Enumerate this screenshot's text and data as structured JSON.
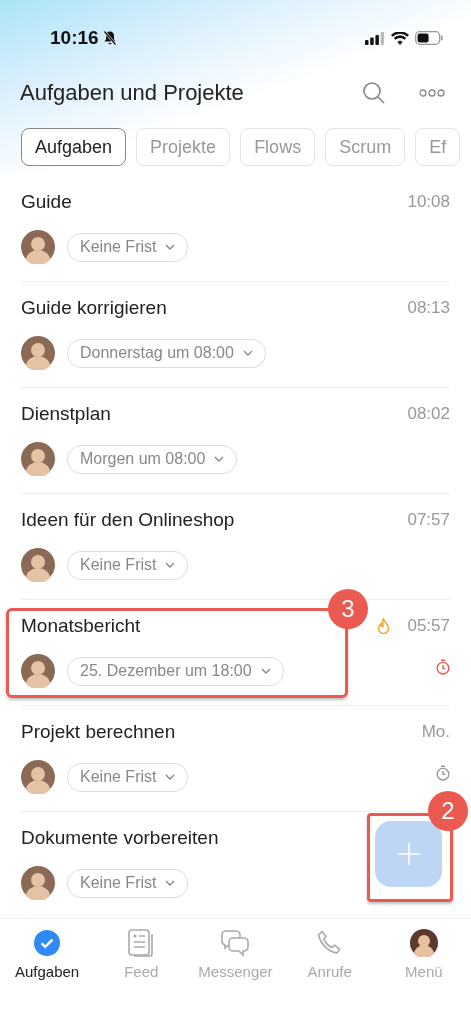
{
  "status_bar": {
    "time": "10:16"
  },
  "header": {
    "title": "Aufgaben und Projekte"
  },
  "tabs": [
    {
      "label": "Aufgaben",
      "selected": true
    },
    {
      "label": "Projekte",
      "selected": false
    },
    {
      "label": "Flows",
      "selected": false
    },
    {
      "label": "Scrum",
      "selected": false
    },
    {
      "label": "Ef",
      "selected": false
    }
  ],
  "tasks": [
    {
      "title": "Guide",
      "time": "10:08",
      "deadline": "Keine Frist",
      "hot": false,
      "timer": false
    },
    {
      "title": "Guide korrigieren",
      "time": "08:13",
      "deadline": "Donnerstag um 08:00",
      "hot": false,
      "timer": false
    },
    {
      "title": "Dienstplan",
      "time": "08:02",
      "deadline": "Morgen um 08:00",
      "hot": false,
      "timer": false
    },
    {
      "title": "Ideen für den Onlineshop",
      "time": "07:57",
      "deadline": "Keine Frist",
      "hot": false,
      "timer": false
    },
    {
      "title": "Monatsbericht",
      "time": "05:57",
      "deadline": "25. Dezember um 18:00",
      "hot": true,
      "timer": true,
      "overdue": true,
      "callout": "3"
    },
    {
      "title": "Projekt berechnen",
      "time": "Mo.",
      "deadline": "Keine Frist",
      "hot": false,
      "timer": true,
      "overdue": false
    },
    {
      "title": "Dokumente vorbereiten",
      "deadline": "Keine Frist",
      "hot": false,
      "timer": false
    }
  ],
  "fab": {
    "callout": "2"
  },
  "nav": [
    {
      "label": "Aufgaben",
      "kind": "tasks",
      "selected": true
    },
    {
      "label": "Feed",
      "kind": "feed",
      "selected": false
    },
    {
      "label": "Messenger",
      "kind": "messenger",
      "selected": false
    },
    {
      "label": "Anrufe",
      "kind": "calls",
      "selected": false
    },
    {
      "label": "Menü",
      "kind": "menu",
      "selected": false
    }
  ]
}
